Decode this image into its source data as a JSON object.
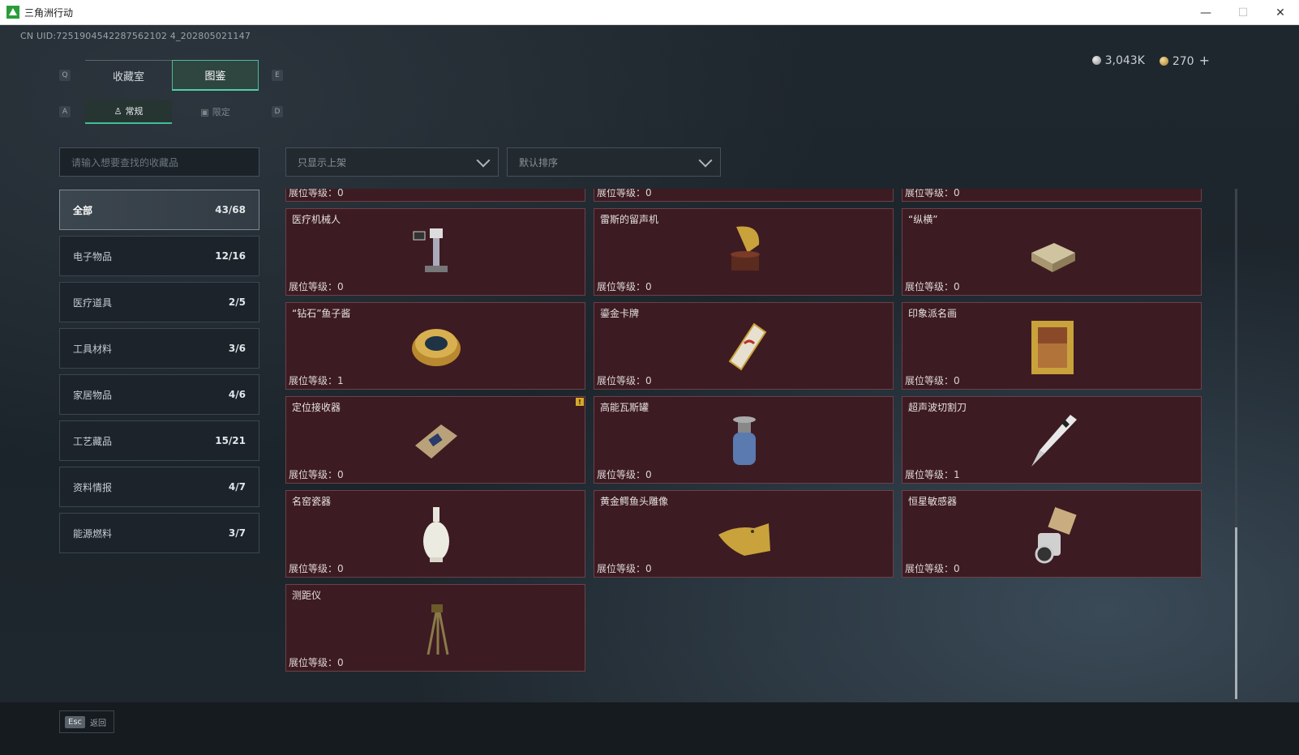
{
  "window": {
    "title": "三角洲行动",
    "minimize": "—",
    "maximize": "☐",
    "close": "✕"
  },
  "uid": "CN UID:7251904542287562102 4_202805021147",
  "currency": {
    "silver": "3,043K",
    "gold": "270",
    "plus": "+"
  },
  "keys": {
    "q": "Q",
    "e": "E",
    "a": "A",
    "d": "D"
  },
  "tabs": [
    {
      "label": "收藏室"
    },
    {
      "label": "图鉴"
    }
  ],
  "subtabs": [
    {
      "label": "常规"
    },
    {
      "label": "限定"
    }
  ],
  "search": {
    "placeholder": "请输入想要查找的收藏品"
  },
  "filters": {
    "shelf": "只显示上架",
    "sort": "默认排序"
  },
  "categories": [
    {
      "label": "全部",
      "count": "43/68"
    },
    {
      "label": "电子物品",
      "count": "12/16"
    },
    {
      "label": "医疗道具",
      "count": "2/5"
    },
    {
      "label": "工具材料",
      "count": "3/6"
    },
    {
      "label": "家居物品",
      "count": "4/6"
    },
    {
      "label": "工艺藏品",
      "count": "15/21"
    },
    {
      "label": "资料情报",
      "count": "4/7"
    },
    {
      "label": "能源燃料",
      "count": "3/7"
    }
  ],
  "level_prefix": "展位等级：",
  "partial_row": [
    "展位等级：0",
    "展位等级：0",
    "展位等级：0"
  ],
  "items": [
    {
      "name": "医疗机械人",
      "level": "0",
      "icon": "medical-robot-icon"
    },
    {
      "name": "雷斯的留声机",
      "level": "0",
      "icon": "gramophone-icon"
    },
    {
      "name": "“纵横”",
      "level": "0",
      "icon": "chess-box-icon"
    },
    {
      "name": "“钻石”鱼子酱",
      "level": "1",
      "icon": "caviar-tin-icon"
    },
    {
      "name": "鎏金卡牌",
      "level": "0",
      "icon": "gilded-card-icon"
    },
    {
      "name": "印象派名画",
      "level": "0",
      "icon": "framed-painting-icon"
    },
    {
      "name": "定位接收器",
      "level": "0",
      "icon": "gps-receiver-icon",
      "warning": "!"
    },
    {
      "name": "高能瓦斯罐",
      "level": "0",
      "icon": "gas-canister-icon"
    },
    {
      "name": "超声波切割刀",
      "level": "1",
      "icon": "ultrasonic-knife-icon"
    },
    {
      "name": "名窑瓷器",
      "level": "0",
      "icon": "porcelain-vase-icon"
    },
    {
      "name": "黄金鳄鱼头雕像",
      "level": "0",
      "icon": "gold-crocodile-statue-icon"
    },
    {
      "name": "恒星敏感器",
      "level": "0",
      "icon": "star-sensor-icon"
    },
    {
      "name": "测距仪",
      "level": "0",
      "icon": "rangefinder-tripod-icon"
    }
  ],
  "footer": {
    "key": "Esc",
    "label": "返回"
  },
  "colors": {
    "accent": "#4fd0a6",
    "card_bg": "#3d1b22",
    "card_border": "#6b4149"
  }
}
